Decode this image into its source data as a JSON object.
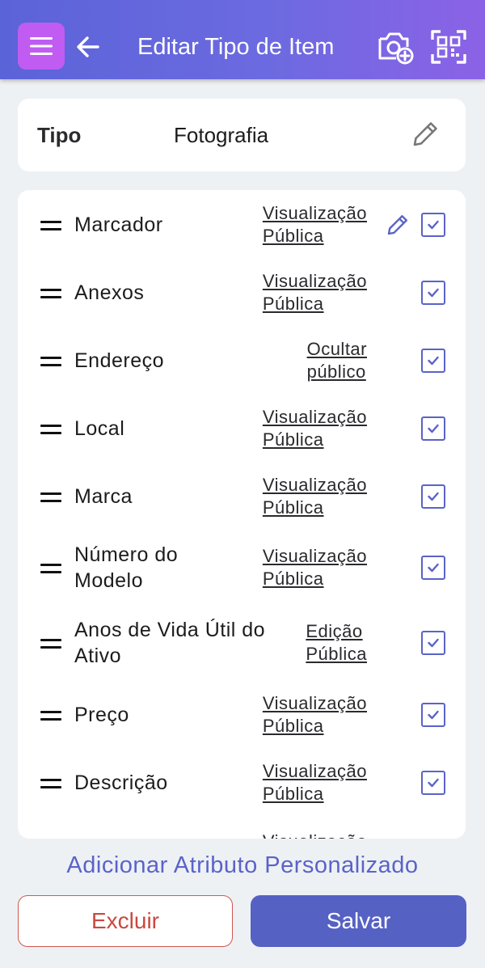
{
  "header": {
    "title": "Editar Tipo de Item",
    "menu_icon": "menu-icon",
    "back_icon": "arrow-left-icon",
    "camera_icon": "camera-add-icon",
    "qr_icon": "qr-scan-icon",
    "gradient_start": "#5b63d8",
    "gradient_end": "#8b62e6",
    "menu_bg": "#c05cf2"
  },
  "type_card": {
    "label": "Tipo",
    "value": "Fotografia",
    "edit_icon": "pencil-icon"
  },
  "attributes": [
    {
      "label_lines": [
        "Marcador"
      ],
      "visibility_lines": [
        "Visualização",
        "Pública"
      ],
      "editable": true,
      "checked": true
    },
    {
      "label_lines": [
        "Anexos"
      ],
      "visibility_lines": [
        "Visualização",
        "Pública"
      ],
      "editable": false,
      "checked": true
    },
    {
      "label_lines": [
        "Endereço"
      ],
      "visibility_lines": [
        "Ocultar",
        "público"
      ],
      "editable": false,
      "checked": true
    },
    {
      "label_lines": [
        "Local"
      ],
      "visibility_lines": [
        "Visualização",
        "Pública"
      ],
      "editable": false,
      "checked": true
    },
    {
      "label_lines": [
        "Marca"
      ],
      "visibility_lines": [
        "Visualização",
        "Pública"
      ],
      "editable": false,
      "checked": true
    },
    {
      "label_lines": [
        "Número do",
        "Modelo"
      ],
      "visibility_lines": [
        "Visualização",
        "Pública"
      ],
      "editable": false,
      "checked": true
    },
    {
      "label_lines": [
        "Anos de Vida Útil do",
        "Ativo"
      ],
      "visibility_lines": [
        "Edição",
        "Pública"
      ],
      "editable": false,
      "checked": true
    },
    {
      "label_lines": [
        "Preço"
      ],
      "visibility_lines": [
        "Visualização",
        "Pública"
      ],
      "editable": false,
      "checked": true
    },
    {
      "label_lines": [
        "Descrição"
      ],
      "visibility_lines": [
        "Visualização",
        "Pública"
      ],
      "editable": false,
      "checked": true
    },
    {
      "label_lines": [
        ""
      ],
      "visibility_lines": [
        "Visualização"
      ],
      "editable": false,
      "checked": false
    }
  ],
  "footer": {
    "add_link": "Adicionar Atributo Personalizado",
    "delete_label": "Excluir",
    "save_label": "Salvar"
  },
  "colors": {
    "accent": "#5a63c8",
    "danger": "#c9483e",
    "save_bg": "#5661c4"
  }
}
